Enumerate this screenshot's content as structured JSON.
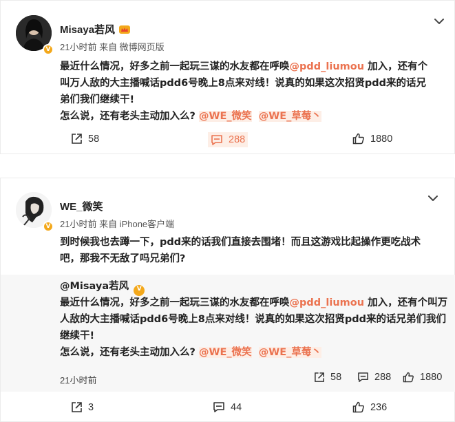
{
  "post1": {
    "username": "Misaya若风",
    "meta": "21小时前 来自 微博网页版",
    "line1_pre": "最近什么情况，好多之前一起玩三谋的水友都在呼唤",
    "line1_mention": "@pdd_liumou",
    "line1_post": " 加入，还有个",
    "line2": "叫万人敌的大主播喊话pdd6号晚上8点来对线！说真的如果这次招贤pdd来的话兄",
    "line3": "弟们我们继续干!",
    "line4_pre": "怎么说，还有老头主动加入么?",
    "line4_mention1": "@WE_微笑",
    "line4_mention2": "@WE_草莓丶",
    "repost_count": "58",
    "comment_count": "288",
    "like_count": "1880"
  },
  "post2": {
    "username": "WE_微笑",
    "meta": "21小时前 来自 iPhone客户端",
    "line1": "到时候我也去蹲一下，pdd来的话我们直接去围堵！而且这游戏比起操作更吃战术",
    "line2": "吧，那我不无敌了吗兄弟们?",
    "quoted": {
      "author": "@Misaya若风",
      "line1_pre": "最近什么情况，好多之前一起玩三谋的水友都在呼唤",
      "line1_mention": "@pdd_liumou",
      "line1_post": " 加入，还有个叫万",
      "line2": "人敌的大主播喊话pdd6号晚上8点来对线！说真的如果这次招贤pdd来的话兄弟们我们",
      "line3": "继续干!",
      "line4_pre": "怎么说，还有老头主动加入么?",
      "line4_mention1": "@WE_微笑",
      "line4_mention2": "@WE_草莓丶",
      "time": "21小时前",
      "repost_count": "58",
      "comment_count": "288",
      "like_count": "1880"
    },
    "repost_count": "3",
    "comment_count": "44",
    "like_count": "236"
  },
  "icons": {
    "verified": "v-badge-icon",
    "crown": "crown-icon",
    "chevron": "chevron-down-icon",
    "repost": "repost-icon",
    "comment": "comment-icon",
    "like": "thumbs-up-icon"
  },
  "colors": {
    "mention": "#eb7350",
    "badge": "#f3a81b",
    "quote_bg": "#f7f7f7"
  }
}
